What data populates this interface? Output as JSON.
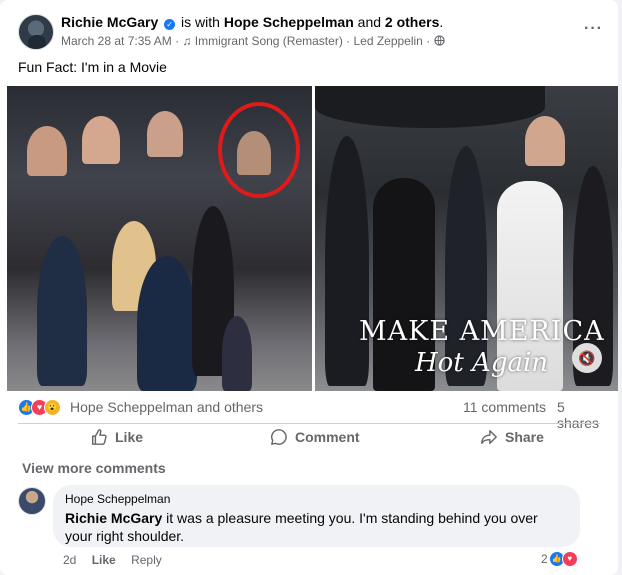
{
  "post": {
    "author": "Richie McGary",
    "with_prefix": "is with",
    "tagged": "Hope Scheppelman",
    "and_word": "and",
    "others": "2 others",
    "date": "March 28 at 7:35 AM",
    "song": "Immigrant Song (Remaster) · Led Zeppelin",
    "text": "Fun Fact: I'm in a Movie"
  },
  "media": {
    "overlay_line1": "MAKE AMERICA",
    "overlay_line2": "Hot Again"
  },
  "stats": {
    "reaction_names": "Hope Scheppelman and others",
    "comments": "11 comments",
    "shares": "5 shares"
  },
  "actions": {
    "like": "Like",
    "comment": "Comment",
    "share": "Share"
  },
  "comments": {
    "view_more": "View more comments",
    "items": [
      {
        "author": "Hope Scheppelman",
        "mention": "Richie McGary",
        "text": " it was a pleasure meeting you. I'm standing behind you over your right shoulder.",
        "time": "2d",
        "like": "Like",
        "reply": "Reply",
        "reaction_count": "2"
      }
    ]
  },
  "colors": {
    "brand_blue": "#1877f2",
    "love_red": "#f33e58",
    "wow_yellow": "#f7b125",
    "circle_red": "#e01a1a"
  }
}
